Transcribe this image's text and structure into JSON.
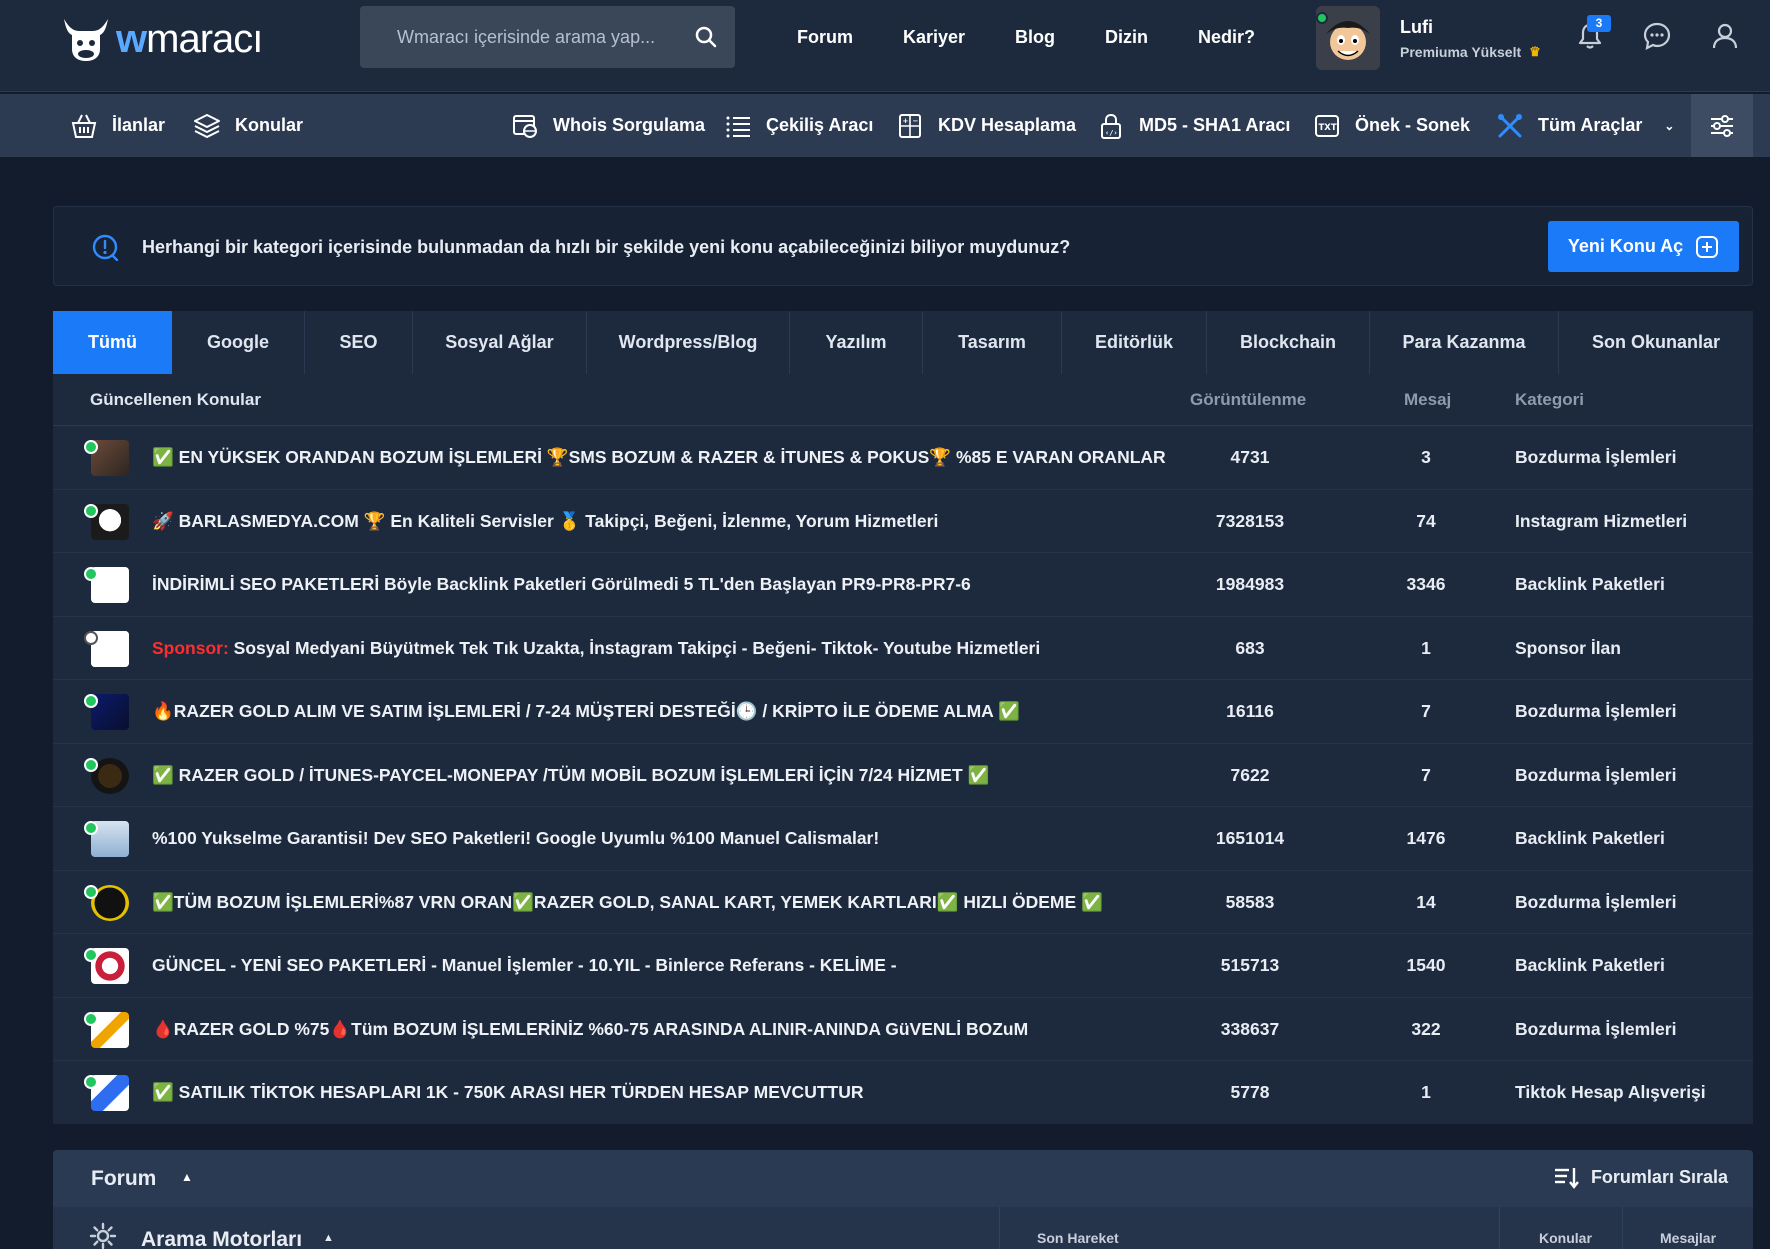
{
  "header": {
    "logo": {
      "w": "w",
      "rest": "maracı"
    },
    "search_placeholder": "Wmaracı içerisinde arama yap...",
    "nav": [
      "Forum",
      "Kariyer",
      "Blog",
      "Dizin",
      "Nedir?"
    ],
    "user": {
      "name": "Lufi",
      "subtitle": "Premiuma Yükselt"
    },
    "notifications_count": "3"
  },
  "subnav": {
    "left": [
      {
        "label": "İlanlar",
        "icon": "basket-icon"
      },
      {
        "label": "Konular",
        "icon": "layers-icon"
      }
    ],
    "tools": [
      {
        "label": "Whois Sorgulama",
        "icon": "globe-lock-icon"
      },
      {
        "label": "Çekiliş Aracı",
        "icon": "list-icon"
      },
      {
        "label": "KDV Hesaplama",
        "icon": "calculator-icon"
      },
      {
        "label": "MD5 - SHA1 Aracı",
        "icon": "lock-code-icon"
      },
      {
        "label": "Önek - Sonek",
        "icon": "txt-icon"
      },
      {
        "label": "Tüm Araçlar",
        "icon": "tools-icon"
      }
    ]
  },
  "banner": {
    "text": "Herhangi bir kategori içerisinde bulunmadan da hızlı bir şekilde yeni konu açabileceğinizi biliyor muydunuz?",
    "button": "Yeni Konu Aç"
  },
  "tabs": [
    "Tümü",
    "Google",
    "SEO",
    "Sosyal Ağlar",
    "Wordpress/Blog",
    "Yazılım",
    "Tasarım",
    "Editörlük",
    "Blockchain",
    "Para Kazanma",
    "Son Okunanlar"
  ],
  "table": {
    "headers": {
      "topic": "Güncellenen Konular",
      "views": "Görüntülenme",
      "msgs": "Mesaj",
      "category": "Kategori"
    },
    "rows": [
      {
        "prefix": "",
        "title": "✅ EN YÜKSEK ORANDAN BOZUM İŞLEMLERİ 🏆SMS BOZUM & RAZER & İTUNES & POKUS🏆 %85 E VARAN ORANLAR",
        "views": "4731",
        "msgs": "3",
        "category": "Bozdurma İşlemleri"
      },
      {
        "prefix": "",
        "title": "🚀 BARLASMEDYA.COM 🏆 En Kaliteli Servisler 🥇 Takipçi, Beğeni, İzlenme, Yorum Hizmetleri",
        "views": "7328153",
        "msgs": "74",
        "category": "Instagram Hizmetleri"
      },
      {
        "prefix": "",
        "title": "İNDİRİMLİ SEO PAKETLERİ Böyle Backlink Paketleri Görülmedi 5 TL'den Başlayan PR9-PR8-PR7-6",
        "views": "1984983",
        "msgs": "3346",
        "category": "Backlink Paketleri"
      },
      {
        "prefix": "Sponsor:",
        "title": " Sosyal Medyani Büyütmek Tek Tık Uzakta, İnstagram Takipçi - Beğeni- Tiktok- Youtube Hizmetleri",
        "views": "683",
        "msgs": "1",
        "category": "Sponsor İlan"
      },
      {
        "prefix": "",
        "title": "🔥RAZER GOLD ALIM VE SATIM İŞLEMLERİ / 7-24 MÜŞTERİ DESTEĞİ🕒 / KRİPTO İLE ÖDEME ALMA ✅",
        "views": "16116",
        "msgs": "7",
        "category": "Bozdurma İşlemleri"
      },
      {
        "prefix": "",
        "title": "✅ RAZER GOLD / İTUNES-PAYCEL-MONEPAY /TÜM MOBİL BOZUM İŞLEMLERİ İÇİN 7/24 HİZMET ✅",
        "views": "7622",
        "msgs": "7",
        "category": "Bozdurma İşlemleri"
      },
      {
        "prefix": "",
        "title": "%100 Yukselme Garantisi! Dev SEO Paketleri! Google Uyumlu %100 Manuel Calismalar!",
        "views": "1651014",
        "msgs": "1476",
        "category": "Backlink Paketleri"
      },
      {
        "prefix": "",
        "title": "✅TÜM BOZUM İŞLEMLERİ%87 VRN ORAN✅RAZER GOLD, SANAL KART, YEMEK KARTLARI✅ HIZLI ÖDEME ✅",
        "views": "58583",
        "msgs": "14",
        "category": "Bozdurma İşlemleri"
      },
      {
        "prefix": "",
        "title": "GÜNCEL - YENİ SEO PAKETLERİ - Manuel İşlemler - 10.YIL - Binlerce Referans - KELİME -",
        "views": "515713",
        "msgs": "1540",
        "category": "Backlink Paketleri"
      },
      {
        "prefix": "",
        "title": "🩸RAZER GOLD %75🩸Tüm BOZUM İŞLEMLERİNİZ %60-75 ARASINDA ALINIR-ANINDA GüVENLİ BOZuM",
        "views": "338637",
        "msgs": "322",
        "category": "Bozdurma İşlemleri"
      },
      {
        "prefix": "",
        "title": "✅ SATILIK TİKTOK HESAPLARI 1K - 750K ARASI HER TÜRDEN HESAP MEVCUTTUR",
        "views": "5778",
        "msgs": "1",
        "category": "Tiktok Hesap Alışverişi"
      }
    ]
  },
  "forum": {
    "label": "Forum",
    "sort_label": "Forumları Sırala",
    "category": "Arama Motorları",
    "columns": {
      "last_activity": "Son Hareket",
      "topics": "Konular",
      "messages": "Mesajlar"
    }
  },
  "colors": {
    "accent": "#1a7af8",
    "online": "#22c55e",
    "sponsor": "#ff2d2d"
  }
}
